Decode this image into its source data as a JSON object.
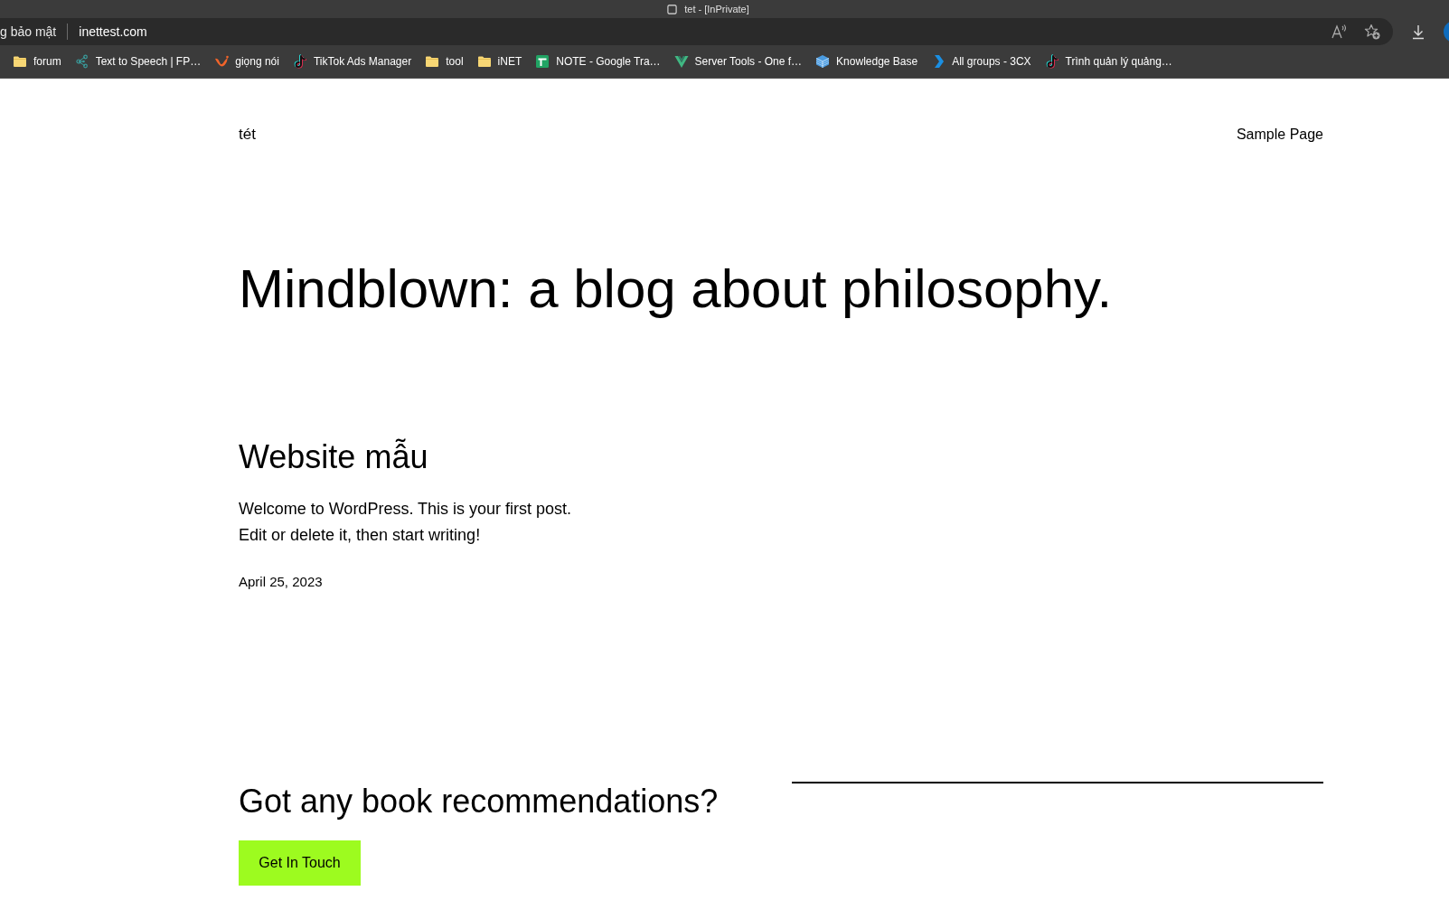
{
  "window": {
    "title": "tet - [InPrivate]"
  },
  "address_bar": {
    "security_label": "g bảo mật",
    "url": "inettest.com"
  },
  "bookmarks": [
    {
      "label": "forum",
      "kind": "folder"
    },
    {
      "label": "Text to Speech | FP…",
      "kind": "nodes"
    },
    {
      "label": "giọng nói",
      "kind": "wave"
    },
    {
      "label": "TikTok Ads Manager",
      "kind": "note"
    },
    {
      "label": "tool",
      "kind": "folder"
    },
    {
      "label": "iNET",
      "kind": "folder"
    },
    {
      "label": "NOTE - Google Tra…",
      "kind": "sheet"
    },
    {
      "label": "Server Tools - One f…",
      "kind": "vee"
    },
    {
      "label": "Knowledge Base",
      "kind": "cube"
    },
    {
      "label": "All groups - 3CX",
      "kind": "chevron"
    },
    {
      "label": "Trình quản lý quảng…",
      "kind": "note"
    }
  ],
  "site": {
    "title": "tét",
    "nav": [
      {
        "label": "Sample Page"
      }
    ]
  },
  "hero": {
    "heading": "Mindblown: a blog about philosophy."
  },
  "posts": [
    {
      "title": "Website mẫu",
      "excerpt": "Welcome to WordPress. This is your first post. Edit or delete it, then start writing!",
      "date": "April 25, 2023"
    }
  ],
  "footer": {
    "heading": "Got any book recommendations?",
    "button": "Get In Touch"
  }
}
